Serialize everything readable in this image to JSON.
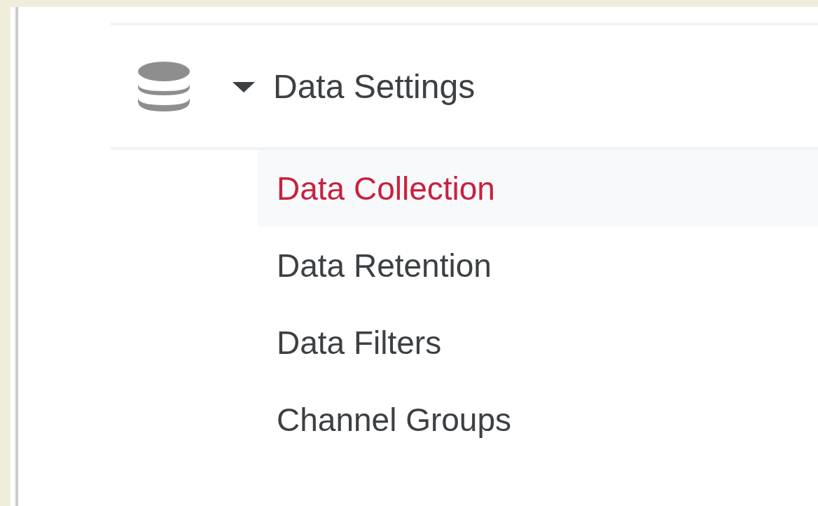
{
  "section": {
    "title": "Data Settings",
    "expanded": true,
    "items": [
      {
        "label": "Data Collection",
        "selected": true
      },
      {
        "label": "Data Retention",
        "selected": false
      },
      {
        "label": "Data Filters",
        "selected": false
      },
      {
        "label": "Channel Groups",
        "selected": false
      }
    ]
  }
}
